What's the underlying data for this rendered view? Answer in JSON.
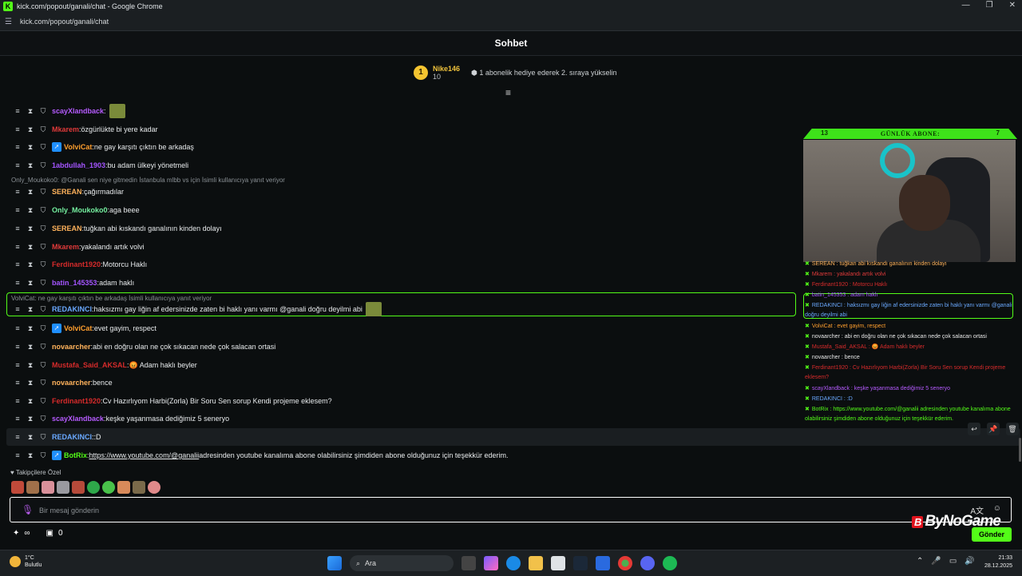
{
  "browser": {
    "title": "kick.com/popout/ganali/chat - Google Chrome",
    "url": "kick.com/popout/ganali/chat",
    "logo": "K"
  },
  "chat": {
    "title": "Sohbet",
    "leader": {
      "rank": "1",
      "name": "Nike146",
      "count": "10",
      "gift_text": "1 abonelik hediye ederek 2. sıraya yükselin"
    },
    "messages": [
      {
        "user": "scayXlandback",
        "color": "#b65bff",
        "text": "",
        "emote": true
      },
      {
        "user": "Mkarem",
        "color": "#e03a3a",
        "text": "özgürlükte bi yere kadar"
      },
      {
        "user": "VolviCat",
        "color": "#ff9f2e",
        "text": "ne gay karşıtı çıktın be arkadaş",
        "badge": "#1f8fff"
      },
      {
        "user": "1abdullah_1903",
        "color": "#a455ff",
        "text": "bu adam ülkeyi yönetmeli"
      },
      {
        "user": "SEREAN",
        "color": "#ffb35c",
        "text": "çağırmadılar",
        "reply": "Only_Moukoko0: @Ganali sen niye gitmedin İstanbula mlbb vs için İsimli kullanıcıya yanıt veriyor"
      },
      {
        "user": "Only_Moukoko0",
        "color": "#75f0a0",
        "text": "aga beee"
      },
      {
        "user": "SEREAN",
        "color": "#ffb35c",
        "text": "tuğkan abi kıskandı ganalının kinden dolayı"
      },
      {
        "user": "Mkarem",
        "color": "#e03a3a",
        "text": "yakalandı artık volvi"
      },
      {
        "user": "Ferdinant1920",
        "color": "#d72b2b",
        "text": "Motorcu Haklı"
      },
      {
        "user": "batin_145353",
        "color": "#a455ff",
        "text": "adam haklı"
      },
      {
        "user": "REDAKINCI",
        "color": "#6aa9ff",
        "text": "haksızmı gay liğin af edersinizde zaten bi haklı yanı varmı @ganali doğru deyilmi abi",
        "reply": "VolviCat: ne gay karşıtı çıktın be arkadaş İsimli kullanıcıya yanıt veriyor",
        "emote": true
      },
      {
        "user": "VolviCat",
        "color": "#ff9f2e",
        "text": "evet gayim, respect",
        "badge": "#1f8fff"
      },
      {
        "user": "novaarcher",
        "color": "#ffb35c",
        "text": "abi en doğru olan ne çok sıkacan nede çok salacan ortasi"
      },
      {
        "user": "Mustafa_Said_AKSAL",
        "color": "#d72b2b",
        "text": "😡 Adam haklı beyler"
      },
      {
        "user": "novaarcher",
        "color": "#ffb35c",
        "text": "bence"
      },
      {
        "user": "Ferdinant1920",
        "color": "#d72b2b",
        "text": "Cv Hazırlıyom Harbi(Zorla) Bir Soru Sen sorup Kendi projeme eklesem?"
      },
      {
        "user": "scayXlandback",
        "color": "#b65bff",
        "text": "keşke yaşanmasa dediğimiz 5 seneryo"
      },
      {
        "user": "REDAKINCI",
        "color": "#6aa9ff",
        "text": ":D"
      },
      {
        "user": "BotRix",
        "color": "#53fc18",
        "text": "adresinden youtube kanalıma abone olabilirsiniz şimdiden abone olduğunuz için teşekkür ederim.",
        "link": "https://www.youtube.com/@ganalii",
        "badge": "#1f8fff"
      }
    ],
    "followers_label": "Takipçilere Özel",
    "input_placeholder": "Bir mesaj gönderin",
    "points": "0",
    "send_label": "Gönder"
  },
  "overlay": {
    "bar_left": "13",
    "bar_label": "GÜNLÜK ABONE:",
    "bar_right": "7",
    "rows": [
      "SEREAN : tuğkan abi kıskandı ganalının kinden dolayı",
      "Mkarem : yakalandı artık volvi",
      "Ferdinant1920 : Motorcu Haklı",
      "batin_145353 : adam haklı",
      "REDAKINCI : haksızmı gay liğin af edersinizde zaten bi haklı yanı varmı @ganali doğru deyilmi abi",
      "VolviCat : evet gayim, respect",
      "novaarcher : abi en doğru olan ne çok sıkacan nede çok salacan ortasi",
      "Mustafa_Said_AKSAL : 😡 Adam haklı beyler",
      "novaarcher : bence",
      "Ferdinant1920 : Cv Hazırlıyom Harbi(Zorla) Bir Soru Sen sorup Kendi projeme eklesem?",
      "scayXlandback : keşke yaşanmasa dediğimiz 5 seneryo",
      "REDAKINCI : :D",
      "BotRix : https://www.youtube.com/@ganalii adresinden youtube kanalıma abone olabilirsiniz şimdiden abone olduğunuz için teşekkür ederim."
    ]
  },
  "watermark": {
    "badge": "B",
    "text": "ByNoGame"
  },
  "taskbar": {
    "temp": "1°C",
    "weather": "Bulutlu",
    "search": "Ara",
    "time": "21:33",
    "date": "28.12.2025"
  }
}
